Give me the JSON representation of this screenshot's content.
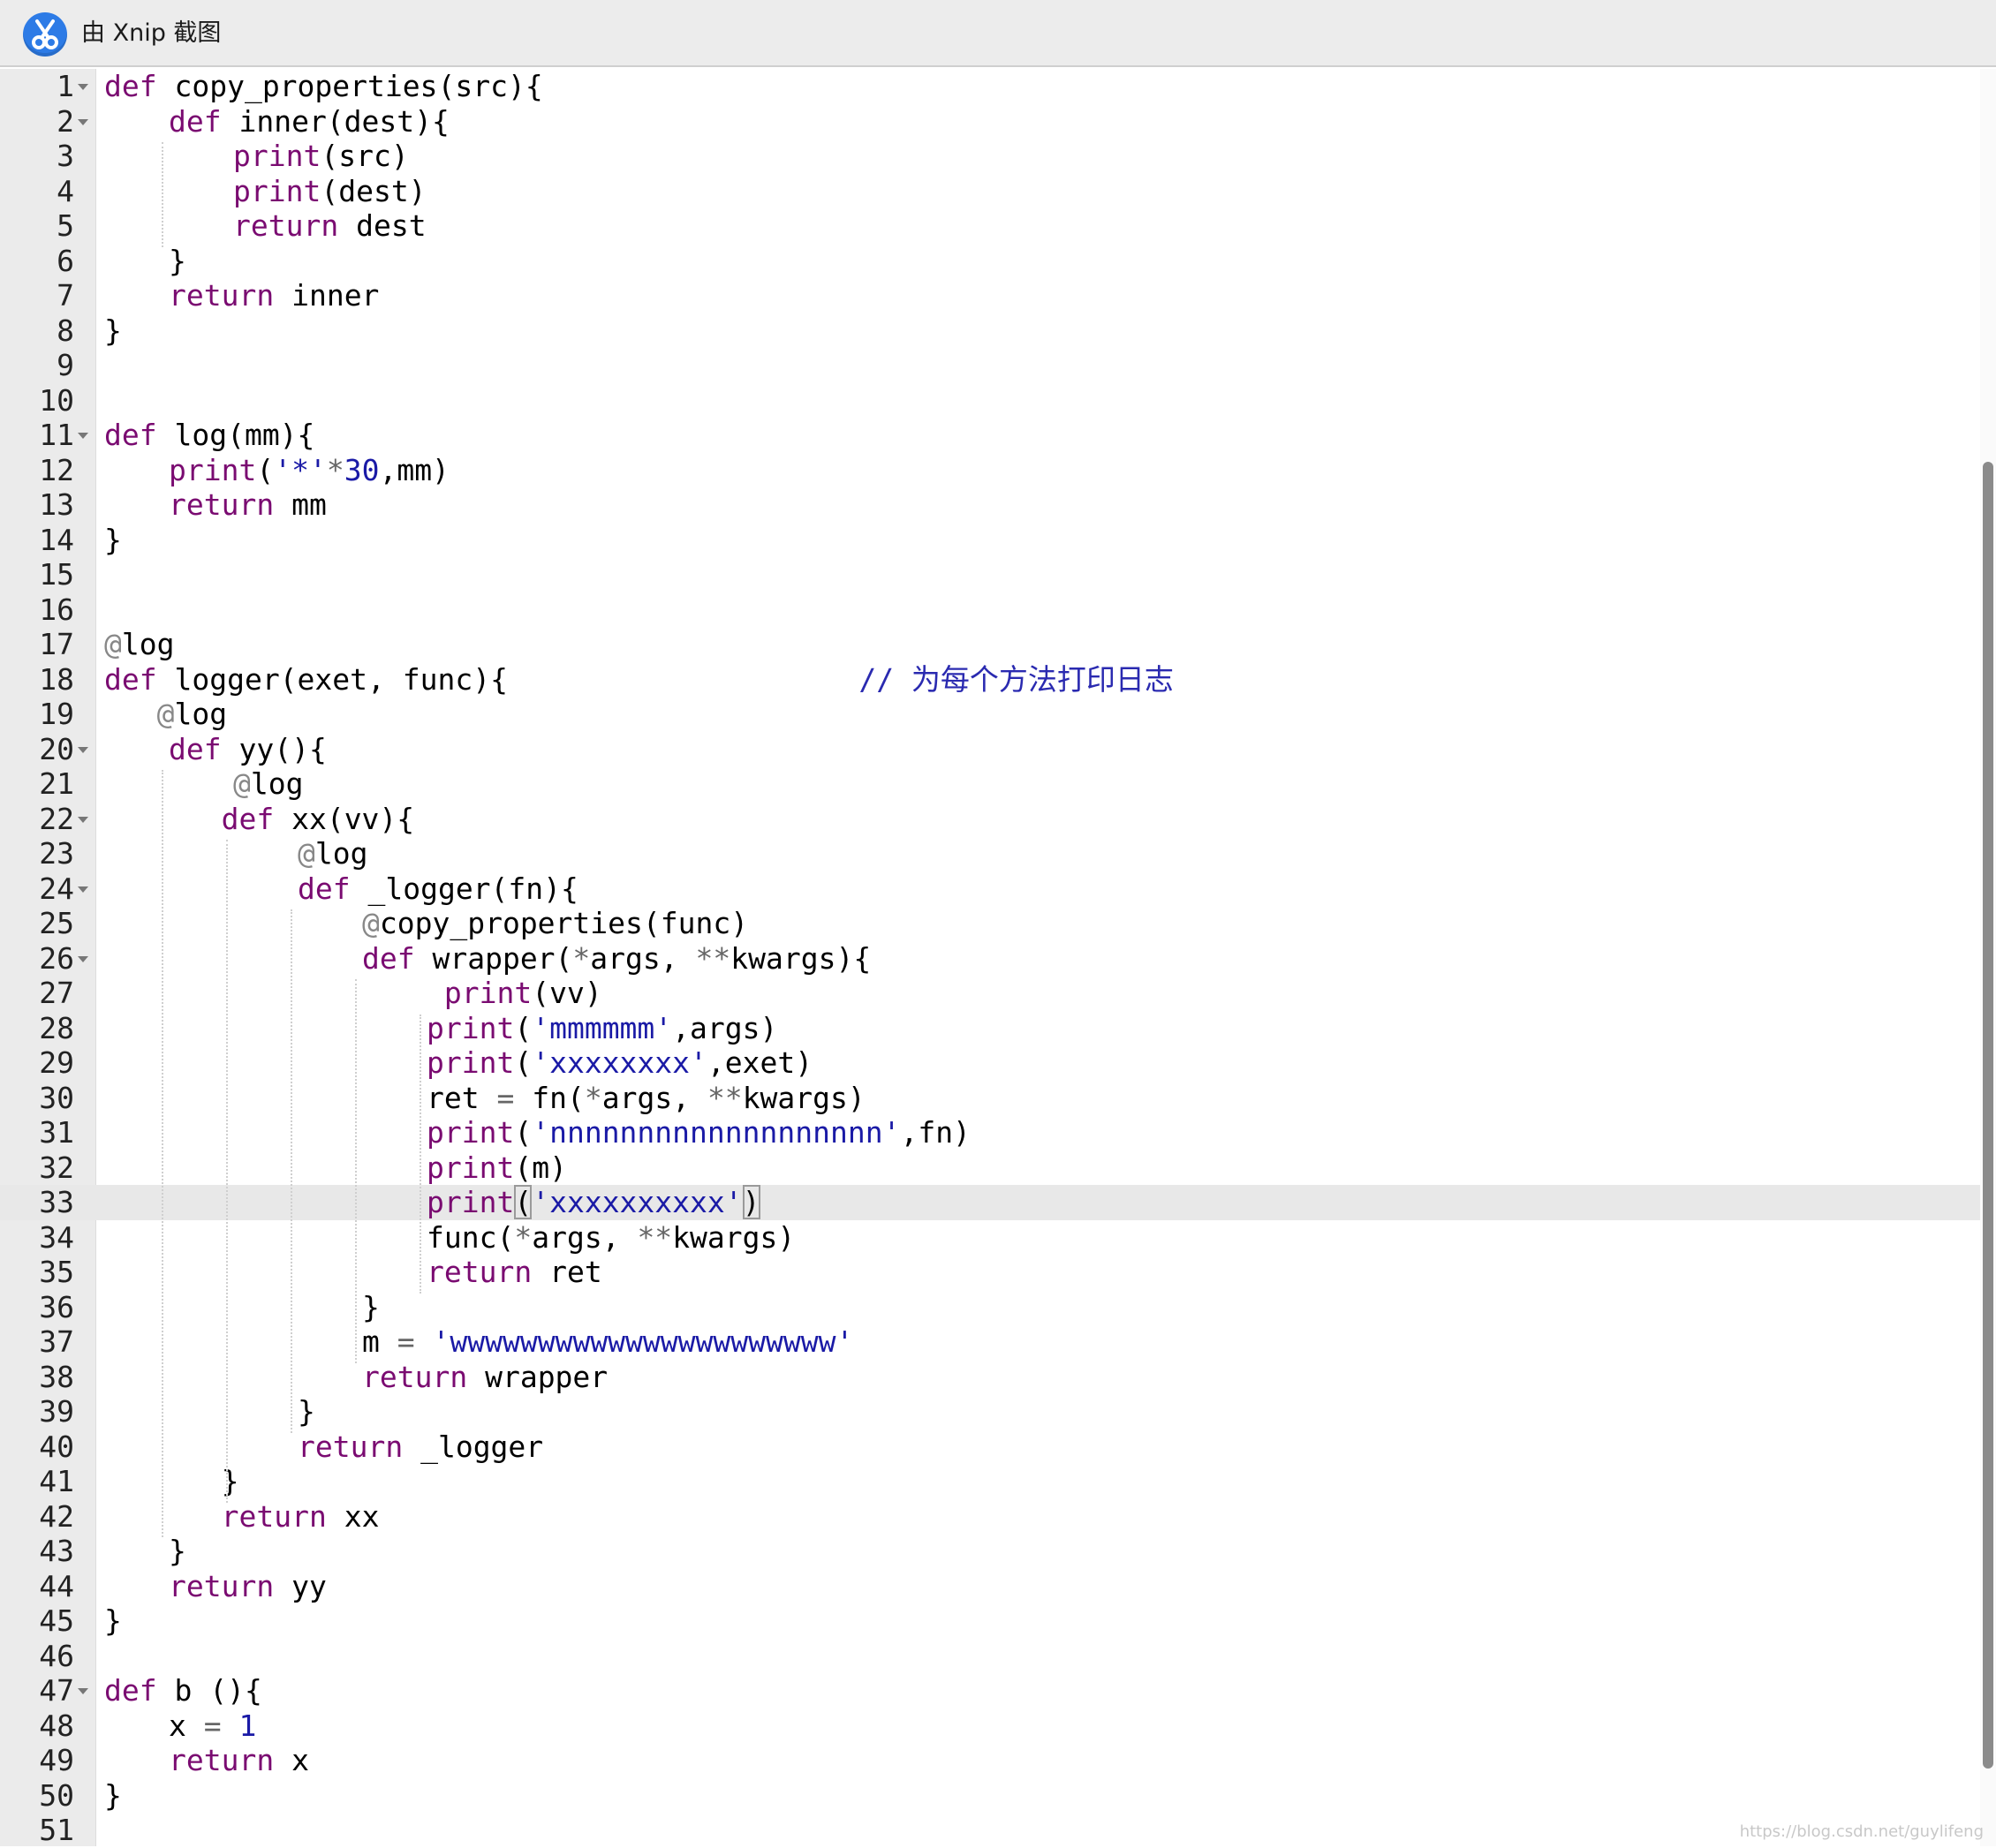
{
  "window": {
    "app_icon": "xnip-scissors-icon",
    "title": "由 Xnip 截图"
  },
  "editor": {
    "active_line": 33,
    "lines": [
      {
        "n": "1",
        "fold": true,
        "indent": 0,
        "t": [
          [
            "kw",
            "def"
          ],
          [
            "id",
            " copy_properties(src){"
          ]
        ]
      },
      {
        "n": "2",
        "fold": true,
        "indent": 1,
        "t": [
          [
            "kw",
            "def"
          ],
          [
            "id",
            " inner(dest){"
          ]
        ]
      },
      {
        "n": "3",
        "fold": false,
        "indent": 2,
        "t": [
          [
            "kw",
            "print"
          ],
          [
            "id",
            "(src)"
          ]
        ]
      },
      {
        "n": "4",
        "fold": false,
        "indent": 2,
        "t": [
          [
            "kw",
            "print"
          ],
          [
            "id",
            "(dest)"
          ]
        ]
      },
      {
        "n": "5",
        "fold": false,
        "indent": 2,
        "t": [
          [
            "kw",
            "return"
          ],
          [
            "id",
            " dest"
          ]
        ]
      },
      {
        "n": "6",
        "fold": false,
        "indent": 1,
        "t": [
          [
            "id",
            "}"
          ]
        ]
      },
      {
        "n": "7",
        "fold": false,
        "indent": 1,
        "t": [
          [
            "kw",
            "return"
          ],
          [
            "id",
            " inner"
          ]
        ]
      },
      {
        "n": "8",
        "fold": false,
        "indent": 0,
        "t": [
          [
            "id",
            "}"
          ]
        ]
      },
      {
        "n": "9",
        "fold": false,
        "indent": 0,
        "t": []
      },
      {
        "n": "10",
        "fold": false,
        "indent": 0,
        "t": []
      },
      {
        "n": "11",
        "fold": true,
        "indent": 0,
        "t": [
          [
            "kw",
            "def"
          ],
          [
            "id",
            " log(mm){"
          ]
        ]
      },
      {
        "n": "12",
        "fold": false,
        "indent": 1,
        "t": [
          [
            "kw",
            "print"
          ],
          [
            "id",
            "("
          ],
          [
            "str",
            "'*'"
          ],
          [
            "op",
            "*"
          ],
          [
            "num",
            "30"
          ],
          [
            "id",
            ",mm)"
          ]
        ]
      },
      {
        "n": "13",
        "fold": false,
        "indent": 1,
        "t": [
          [
            "kw",
            "return"
          ],
          [
            "id",
            " mm"
          ]
        ]
      },
      {
        "n": "14",
        "fold": false,
        "indent": 0,
        "t": [
          [
            "id",
            "}"
          ]
        ]
      },
      {
        "n": "15",
        "fold": false,
        "indent": 0,
        "t": []
      },
      {
        "n": "16",
        "fold": false,
        "indent": 0,
        "t": []
      },
      {
        "n": "17",
        "fold": false,
        "indent": 0,
        "t": [
          [
            "dec",
            "@"
          ],
          [
            "id",
            "log"
          ]
        ]
      },
      {
        "n": "18",
        "fold": false,
        "indent": 0,
        "t": [
          [
            "kw",
            "def"
          ],
          [
            "id",
            " logger(exet, func){"
          ],
          [
            "id",
            "                    "
          ],
          [
            "com",
            "// 为每个方法打印日志"
          ]
        ]
      },
      {
        "n": "19",
        "fold": false,
        "indent": 0,
        "t": [
          [
            "id",
            "   "
          ],
          [
            "dec",
            "@"
          ],
          [
            "id",
            "log"
          ]
        ]
      },
      {
        "n": "20",
        "fold": true,
        "indent": 1,
        "t": [
          [
            "kw",
            "def"
          ],
          [
            "id",
            " yy(){"
          ]
        ]
      },
      {
        "n": "21",
        "fold": false,
        "indent": 2,
        "t": [
          [
            "dec",
            "@"
          ],
          [
            "id",
            "log"
          ]
        ]
      },
      {
        "n": "22",
        "fold": true,
        "indent": 1,
        "t": [
          [
            "id",
            "   "
          ],
          [
            "kw",
            "def"
          ],
          [
            "id",
            " xx(vv){"
          ]
        ]
      },
      {
        "n": "23",
        "fold": false,
        "indent": 3,
        "t": [
          [
            "dec",
            "@"
          ],
          [
            "id",
            "log"
          ]
        ]
      },
      {
        "n": "24",
        "fold": true,
        "indent": 3,
        "t": [
          [
            "kw",
            "def"
          ],
          [
            "id",
            " _logger(fn){"
          ]
        ]
      },
      {
        "n": "25",
        "fold": false,
        "indent": 4,
        "t": [
          [
            "dec",
            "@"
          ],
          [
            "id",
            "copy_properties(func)"
          ]
        ]
      },
      {
        "n": "26",
        "fold": true,
        "indent": 4,
        "t": [
          [
            "kw",
            "def"
          ],
          [
            "id",
            " wrapper("
          ],
          [
            "op",
            "*"
          ],
          [
            "id",
            "args, "
          ],
          [
            "op",
            "**"
          ],
          [
            "id",
            "kwargs){"
          ]
        ]
      },
      {
        "n": "27",
        "fold": false,
        "indent": 5,
        "t": [
          [
            "id",
            " "
          ],
          [
            "kw",
            "print"
          ],
          [
            "id",
            "(vv)"
          ]
        ]
      },
      {
        "n": "28",
        "fold": false,
        "indent": 5,
        "t": [
          [
            "kw",
            "print"
          ],
          [
            "id",
            "("
          ],
          [
            "str",
            "'mmmmmm'"
          ],
          [
            "id",
            ",args)"
          ]
        ]
      },
      {
        "n": "29",
        "fold": false,
        "indent": 5,
        "t": [
          [
            "kw",
            "print"
          ],
          [
            "id",
            "("
          ],
          [
            "str",
            "'xxxxxxxx'"
          ],
          [
            "id",
            ",exet)"
          ]
        ]
      },
      {
        "n": "30",
        "fold": false,
        "indent": 5,
        "t": [
          [
            "id",
            "ret "
          ],
          [
            "op",
            "="
          ],
          [
            "id",
            " fn("
          ],
          [
            "op",
            "*"
          ],
          [
            "id",
            "args, "
          ],
          [
            "op",
            "**"
          ],
          [
            "id",
            "kwargs)"
          ]
        ]
      },
      {
        "n": "31",
        "fold": false,
        "indent": 5,
        "t": [
          [
            "kw",
            "print"
          ],
          [
            "id",
            "("
          ],
          [
            "str",
            "'nnnnnnnnnnnnnnnnnnn'"
          ],
          [
            "id",
            ",fn)"
          ]
        ]
      },
      {
        "n": "32",
        "fold": false,
        "indent": 5,
        "t": [
          [
            "kw",
            "print"
          ],
          [
            "id",
            "(m)"
          ]
        ]
      },
      {
        "n": "33",
        "fold": false,
        "indent": 5,
        "t": [
          [
            "kw",
            "print"
          ],
          [
            "br",
            "("
          ],
          [
            "str",
            "'xxxxxxxxxx'"
          ],
          [
            "br",
            ")"
          ]
        ]
      },
      {
        "n": "34",
        "fold": false,
        "indent": 5,
        "t": [
          [
            "id",
            "func("
          ],
          [
            "op",
            "*"
          ],
          [
            "id",
            "args, "
          ],
          [
            "op",
            "**"
          ],
          [
            "id",
            "kwargs)"
          ]
        ]
      },
      {
        "n": "35",
        "fold": false,
        "indent": 5,
        "t": [
          [
            "kw",
            "return"
          ],
          [
            "id",
            " ret"
          ]
        ]
      },
      {
        "n": "36",
        "fold": false,
        "indent": 4,
        "t": [
          [
            "id",
            "}"
          ]
        ]
      },
      {
        "n": "37",
        "fold": false,
        "indent": 4,
        "t": [
          [
            "id",
            "m "
          ],
          [
            "op",
            "="
          ],
          [
            "id",
            " "
          ],
          [
            "str",
            "'wwwwwwwwwwwwwwwwwwwwww'"
          ]
        ]
      },
      {
        "n": "38",
        "fold": false,
        "indent": 4,
        "t": [
          [
            "kw",
            "return"
          ],
          [
            "id",
            " wrapper"
          ]
        ]
      },
      {
        "n": "39",
        "fold": false,
        "indent": 3,
        "t": [
          [
            "id",
            "}"
          ]
        ]
      },
      {
        "n": "40",
        "fold": false,
        "indent": 3,
        "t": [
          [
            "kw",
            "return"
          ],
          [
            "id",
            " _logger"
          ]
        ]
      },
      {
        "n": "41",
        "fold": false,
        "indent": 1,
        "t": [
          [
            "id",
            "   }"
          ]
        ]
      },
      {
        "n": "42",
        "fold": false,
        "indent": 1,
        "t": [
          [
            "id",
            "   "
          ],
          [
            "kw",
            "return"
          ],
          [
            "id",
            " xx"
          ]
        ]
      },
      {
        "n": "43",
        "fold": false,
        "indent": 1,
        "t": [
          [
            "id",
            "}"
          ]
        ]
      },
      {
        "n": "44",
        "fold": false,
        "indent": 1,
        "t": [
          [
            "kw",
            "return"
          ],
          [
            "id",
            " yy"
          ]
        ]
      },
      {
        "n": "45",
        "fold": false,
        "indent": 0,
        "t": [
          [
            "id",
            "}"
          ]
        ]
      },
      {
        "n": "46",
        "fold": false,
        "indent": 0,
        "t": []
      },
      {
        "n": "47",
        "fold": true,
        "indent": 0,
        "t": [
          [
            "kw",
            "def"
          ],
          [
            "id",
            " b (){"
          ]
        ]
      },
      {
        "n": "48",
        "fold": false,
        "indent": 1,
        "t": [
          [
            "id",
            "x "
          ],
          [
            "op",
            "="
          ],
          [
            "id",
            " "
          ],
          [
            "num",
            "1"
          ]
        ]
      },
      {
        "n": "49",
        "fold": false,
        "indent": 1,
        "t": [
          [
            "kw",
            "return"
          ],
          [
            "id",
            " x"
          ]
        ]
      },
      {
        "n": "50",
        "fold": false,
        "indent": 0,
        "t": [
          [
            "id",
            "}"
          ]
        ]
      },
      {
        "n": "51",
        "fold": false,
        "indent": 0,
        "t": []
      }
    ]
  },
  "watermark": "https://blog.csdn.net/guylifeng",
  "colors": {
    "keyword": "#7a0b71",
    "string": "#1a1aa6",
    "decorator": "#888888",
    "active_line": "#e8e8e8",
    "gutter": "#ebebeb"
  }
}
